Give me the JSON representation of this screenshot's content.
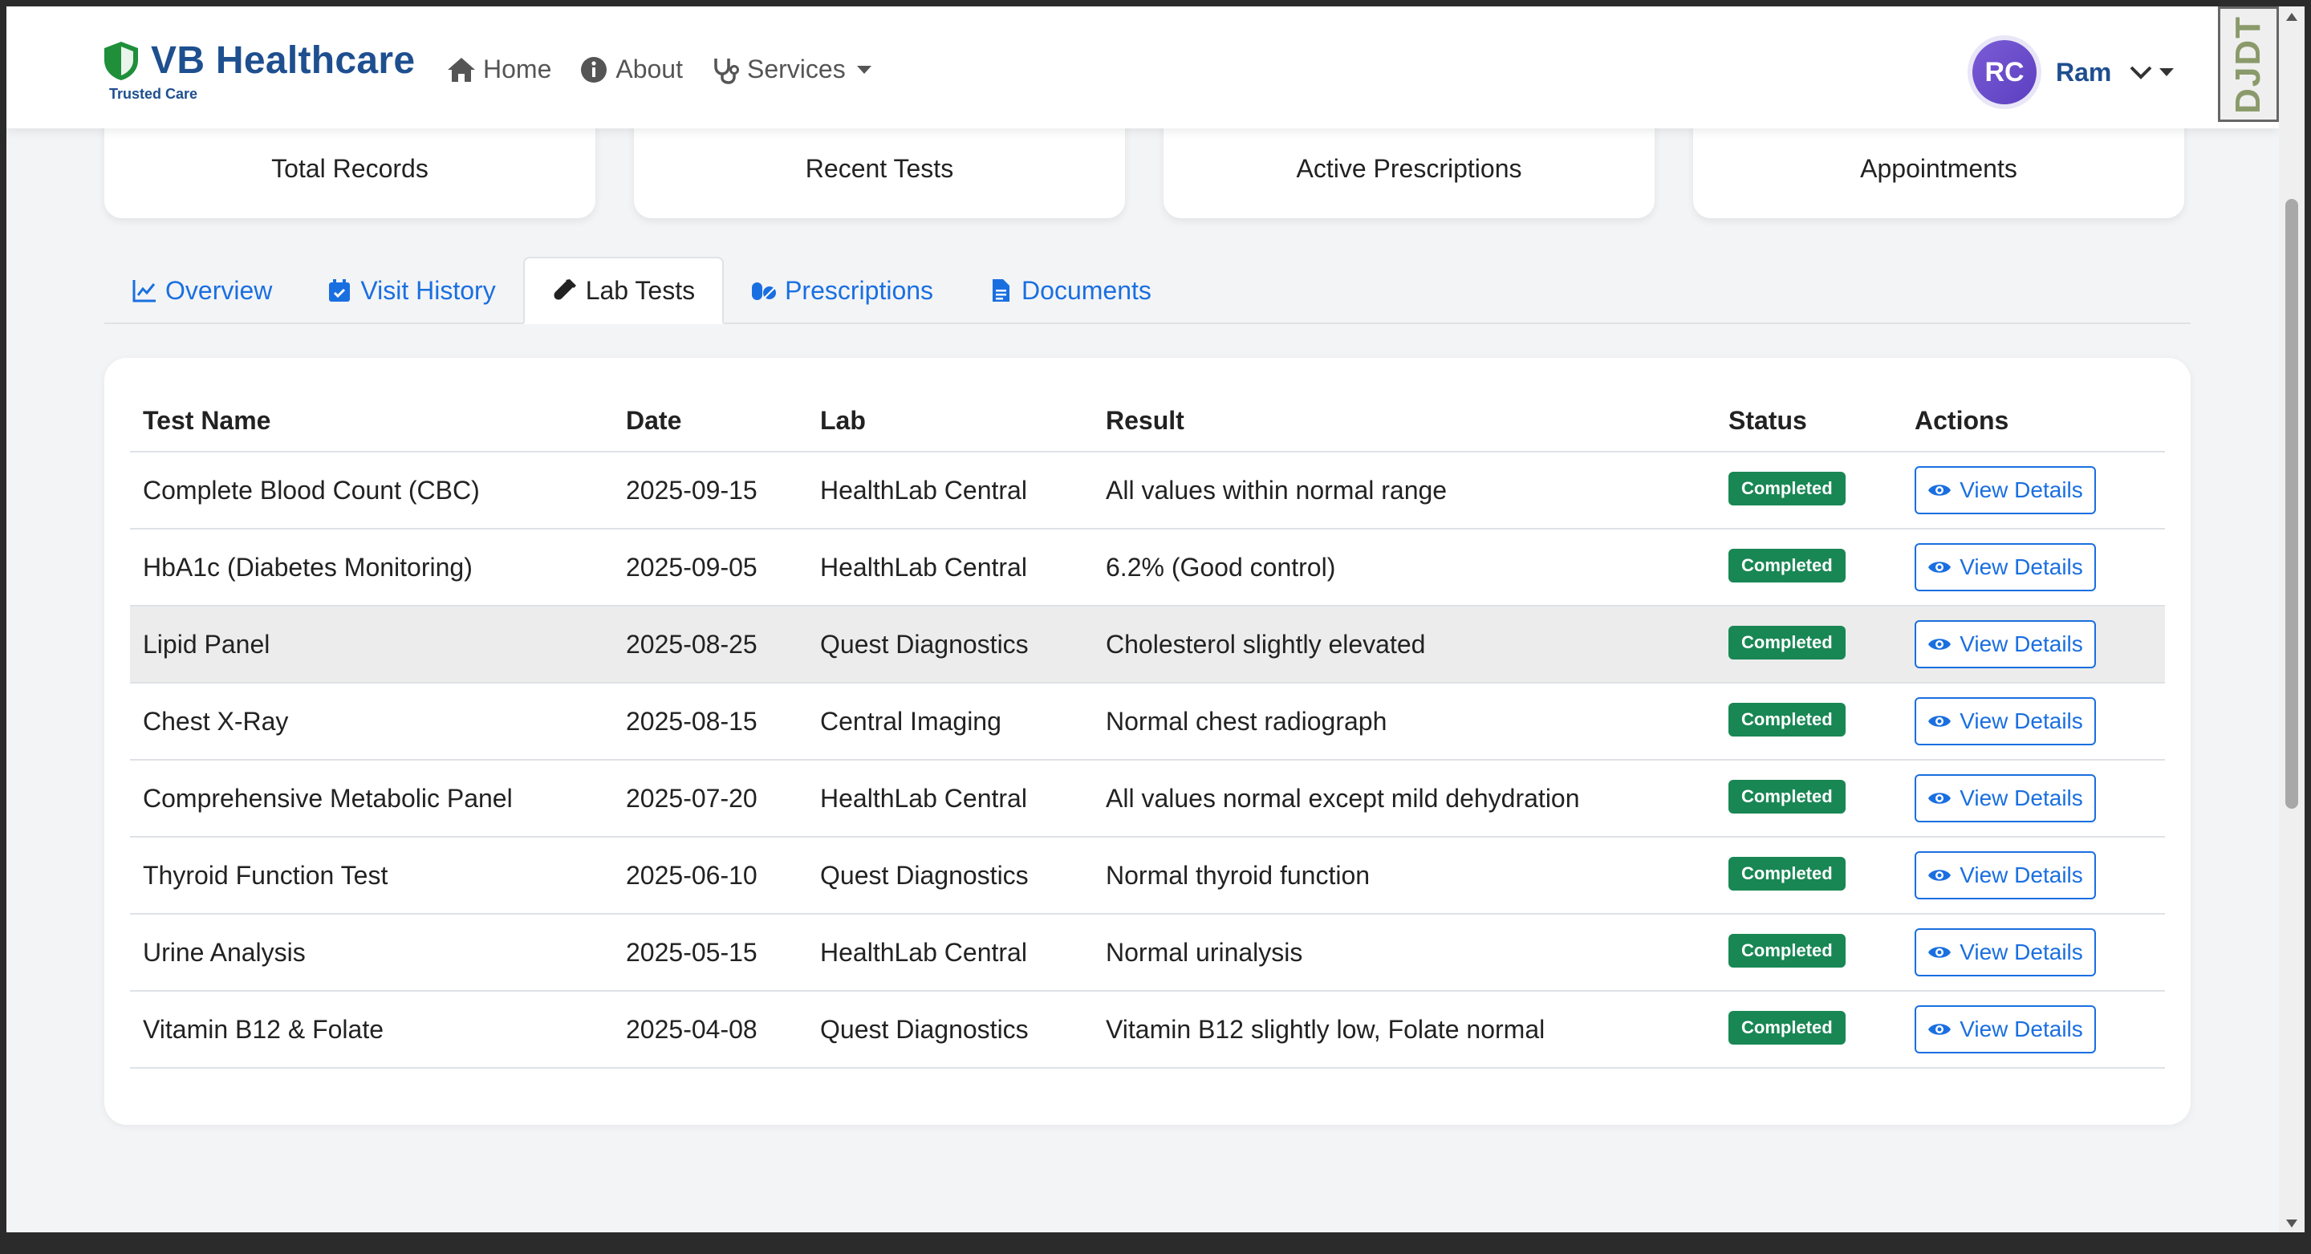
{
  "brand": {
    "name": "VB Healthcare",
    "tagline": "Trusted Care",
    "icon": "shield-check-icon",
    "color": "#1e4f8f",
    "icon_color": "#1f8f3a"
  },
  "nav": {
    "home": "Home",
    "about": "About",
    "services": "Services"
  },
  "user": {
    "initials": "RC",
    "name": "Ram"
  },
  "corner_badge": "DJDT",
  "stats": [
    "Total Records",
    "Recent Tests",
    "Active Prescriptions",
    "Appointments"
  ],
  "tabs": [
    {
      "label": "Overview",
      "icon": "chart-line-icon"
    },
    {
      "label": "Visit History",
      "icon": "calendar-icon"
    },
    {
      "label": "Lab Tests",
      "icon": "vial-icon",
      "active": true
    },
    {
      "label": "Prescriptions",
      "icon": "pills-icon"
    },
    {
      "label": "Documents",
      "icon": "file-icon"
    }
  ],
  "table": {
    "headers": [
      "Test Name",
      "Date",
      "Lab",
      "Result",
      "Status",
      "Actions"
    ],
    "rows": [
      {
        "test": "Complete Blood Count (CBC)",
        "date": "2025-09-15",
        "lab": "HealthLab Central",
        "result": "All values within normal range",
        "status": "Completed",
        "action": "View Details"
      },
      {
        "test": "HbA1c (Diabetes Monitoring)",
        "date": "2025-09-05",
        "lab": "HealthLab Central",
        "result": "6.2% (Good control)",
        "status": "Completed",
        "action": "View Details"
      },
      {
        "test": "Lipid Panel",
        "date": "2025-08-25",
        "lab": "Quest Diagnostics",
        "result": "Cholesterol slightly elevated",
        "status": "Completed",
        "action": "View Details"
      },
      {
        "test": "Chest X-Ray",
        "date": "2025-08-15",
        "lab": "Central Imaging",
        "result": "Normal chest radiograph",
        "status": "Completed",
        "action": "View Details"
      },
      {
        "test": "Comprehensive Metabolic Panel",
        "date": "2025-07-20",
        "lab": "HealthLab Central",
        "result": "All values normal except mild dehydration",
        "status": "Completed",
        "action": "View Details"
      },
      {
        "test": "Thyroid Function Test",
        "date": "2025-06-10",
        "lab": "Quest Diagnostics",
        "result": "Normal thyroid function",
        "status": "Completed",
        "action": "View Details"
      },
      {
        "test": "Urine Analysis",
        "date": "2025-05-15",
        "lab": "HealthLab Central",
        "result": "Normal urinalysis",
        "status": "Completed",
        "action": "View Details"
      },
      {
        "test": "Vitamin B12 & Folate",
        "date": "2025-04-08",
        "lab": "Quest Diagnostics",
        "result": "Vitamin B12 slightly low, Folate normal",
        "status": "Completed",
        "action": "View Details"
      }
    ]
  },
  "colors": {
    "link": "#1a6fe0",
    "success": "#198754",
    "avatar": "#6a4fd0"
  }
}
